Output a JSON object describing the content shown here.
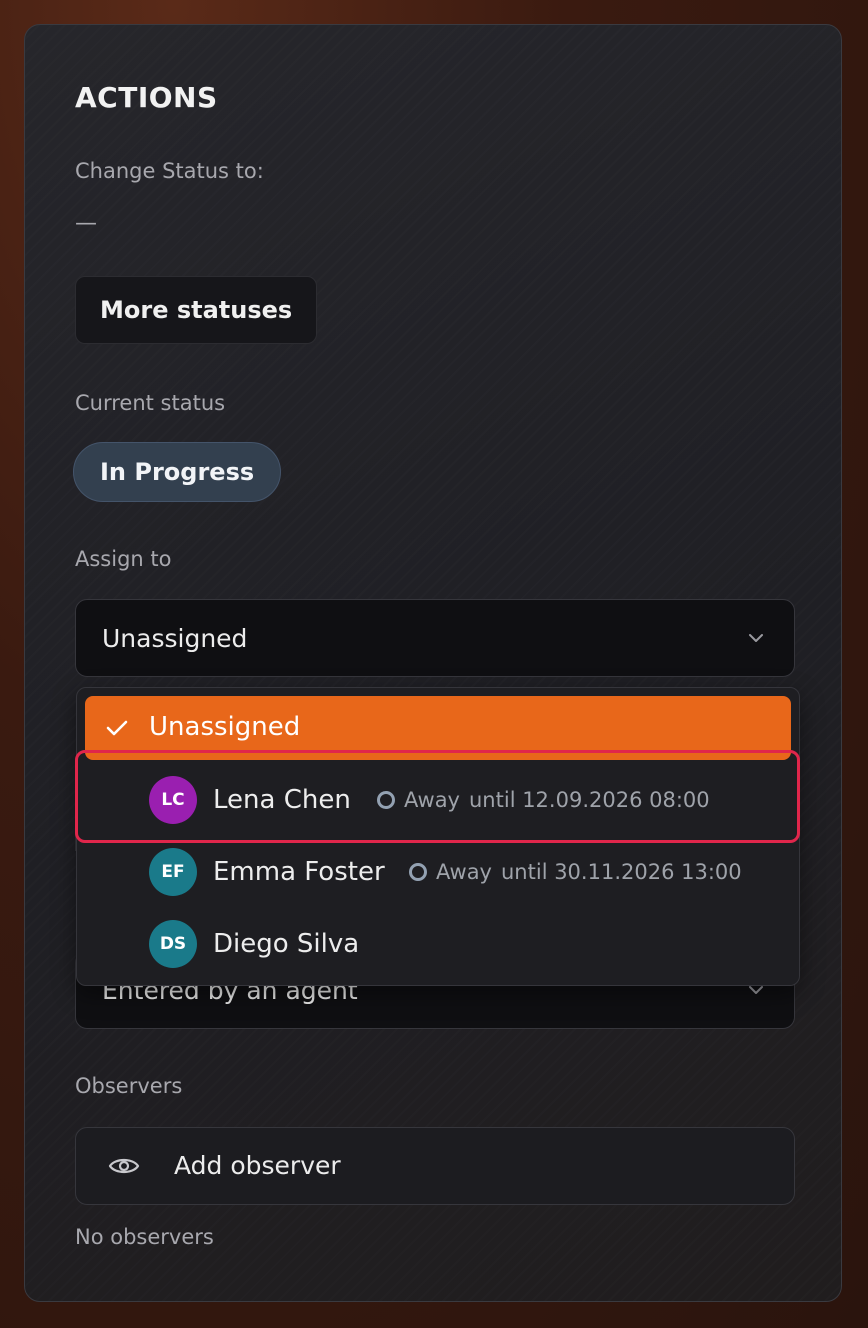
{
  "actions": {
    "heading": "ACTIONS",
    "change_status_label": "Change Status to:",
    "change_status_value": "—",
    "more_statuses_label": "More statuses",
    "current_status_label": "Current status",
    "current_status_value": "In Progress",
    "assign_to_label": "Assign to",
    "assign_to_value": "Unassigned",
    "source_value": "Entered by an agent",
    "observers_label": "Observers",
    "add_observer_label": "Add observer",
    "no_observers_text": "No observers"
  },
  "assign_dropdown": {
    "selected_option": "Unassigned",
    "options": [
      {
        "initials": "LC",
        "name": "Lena Chen",
        "status_word": "Away",
        "until_text": "until 12.09.2026 08:00",
        "avatar_color": "#9a1fb0",
        "highlighted": true
      },
      {
        "initials": "EF",
        "name": "Emma Foster",
        "status_word": "Away",
        "until_text": "until 30.11.2026 13:00",
        "avatar_color": "#1a7a8a",
        "highlighted": false
      },
      {
        "initials": "DS",
        "name": "Diego Silva",
        "status_word": "",
        "until_text": "",
        "avatar_color": "#1a7a8a",
        "highlighted": false
      }
    ]
  },
  "colors": {
    "accent": "#e8671a",
    "highlight_border": "#e0264b",
    "status_pill": "#33404f",
    "away_ring": "#93a1b2"
  },
  "icons": {
    "check": "check-icon",
    "chevron": "chevron-down-icon",
    "eye": "eye-icon",
    "away": "away-status-icon"
  }
}
